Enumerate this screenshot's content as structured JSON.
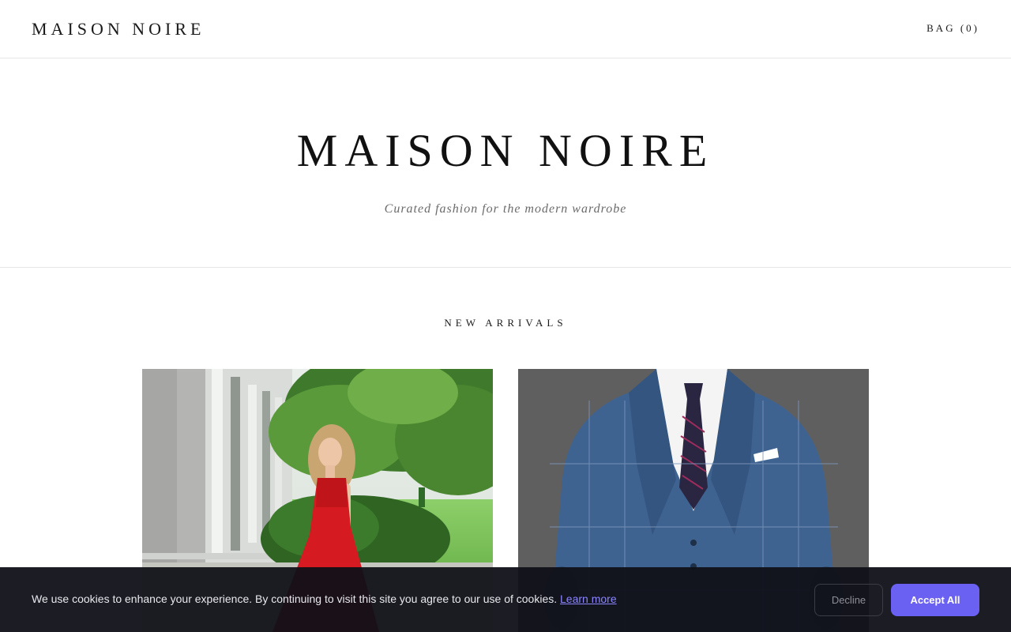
{
  "nav": {
    "brand": "MAISON NOIRE",
    "bag": "BAG (0)"
  },
  "hero": {
    "title": "MAISON NOIRE",
    "subtitle": "Curated fashion for the modern wardrobe"
  },
  "collection": {
    "title": "NEW ARRIVALS"
  },
  "cookie": {
    "message": "We use cookies to enhance your experience. By continuing to visit this site you agree to our use of cookies.",
    "learn_more": "Learn more",
    "decline": "Decline",
    "accept": "Accept All"
  },
  "colors": {
    "accent": "#6a61f2",
    "dress": "#d61a22",
    "suit": "#3f6391",
    "banner": "#101018"
  }
}
